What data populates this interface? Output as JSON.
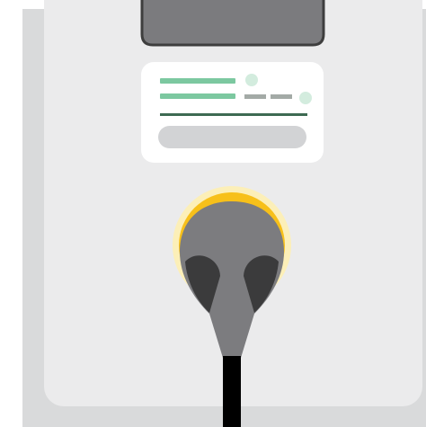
{
  "illustration": {
    "subject": "ev-charging-station-with-plug",
    "icons": [
      "charging-station-icon",
      "screen-icon",
      "info-card-icon",
      "plug-icon",
      "glow-ring-icon",
      "cable-icon"
    ],
    "colors": {
      "background": "#ffffff",
      "station_outer": "#d9dadb",
      "station_inner": "#ebebec",
      "screen": "#7b7b7e",
      "screen_border": "#3e3e3e",
      "card": "#ffffff",
      "card_line_green": "#7cc8a0",
      "card_dot_green": "#d3ecde",
      "card_dash_grey": "#a3aaa6",
      "card_divider": "#3e6a52",
      "card_pill": "#d2d3d5",
      "glow_outer": "#fcefb8",
      "glow_ring": "#f7c01a",
      "plug_body": "#7c7c7f",
      "plug_shadow": "#3b3b3c",
      "cable": "#000000"
    }
  }
}
